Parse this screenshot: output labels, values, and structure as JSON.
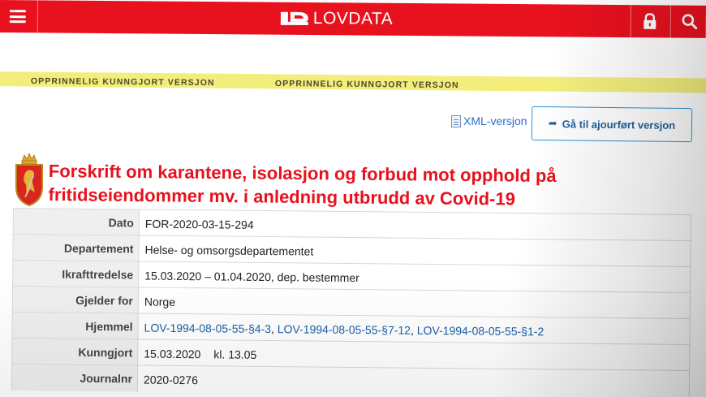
{
  "header": {
    "brand": "LOVDATA",
    "menu_icon": "hamburger-menu-icon",
    "lock_icon": "lock-icon",
    "search_icon": "search-icon",
    "brand_color": "#e8111e"
  },
  "banner": {
    "labels": [
      "OPPRINNELIG KUNNGJORT VERSJON",
      "OPPRINNELIG KUNNGJORT VERSJON"
    ],
    "color": "#f3ee7c"
  },
  "actions": {
    "xml_label": "XML-versjon",
    "goto_label": "Gå til ajourført versjon"
  },
  "document": {
    "title": "Forskrift om karantene, isolasjon og forbud mot opphold på fritidseiendommer mv. i anledning utbrudd av Covid-19",
    "title_color": "#e8111e",
    "metadata": [
      {
        "key": "Dato",
        "value": "FOR-2020-03-15-294"
      },
      {
        "key": "Departement",
        "value": "Helse- og omsorgsdepartementet"
      },
      {
        "key": "Ikrafttredelse",
        "value": "15.03.2020 – 01.04.2020, dep. bestemmer"
      },
      {
        "key": "Gjelder for",
        "value": "Norge"
      },
      {
        "key": "Hjemmel",
        "links": [
          "LOV-1994-08-05-55-§4-3",
          "LOV-1994-08-05-55-§7-12",
          "LOV-1994-08-05-55-§1-2"
        ]
      },
      {
        "key": "Kunngjort",
        "value": "15.03.2020",
        "time": "kl. 13.05"
      },
      {
        "key": "Journalnr",
        "value": "2020-0276"
      }
    ]
  }
}
